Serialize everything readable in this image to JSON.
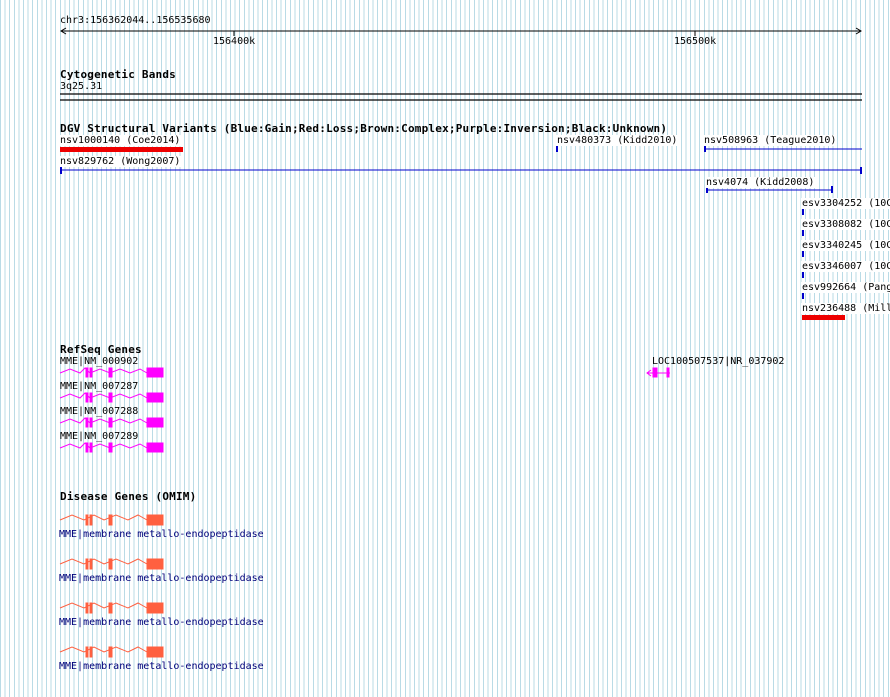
{
  "ruler": {
    "position": "chr3:156362044..156535680",
    "tick_labels": [
      "156400k",
      "156500k"
    ]
  },
  "cyto": {
    "title": "Cytogenetic Bands",
    "band": "3q25.31"
  },
  "dgv": {
    "title": "DGV Structural Variants (Blue:Gain;Red:Loss;Brown:Complex;Purple:Inversion;Black:Unknown)",
    "variants": [
      {
        "label": "nsv1000140 (Coe2014)",
        "type": "Loss"
      },
      {
        "label": "nsv480373 (Kidd2010)",
        "type": "Gain"
      },
      {
        "label": "nsv508963 (Teague2010)",
        "type": "Gain"
      },
      {
        "label": "nsv829762 (Wong2007)",
        "type": "Gain"
      },
      {
        "label": "nsv4074 (Kidd2008)",
        "type": "Gain"
      },
      {
        "label": "esv3304252 (10C",
        "type": "Gain"
      },
      {
        "label": "esv3308082 (10C",
        "type": "Gain"
      },
      {
        "label": "esv3340245 (10C",
        "type": "Gain"
      },
      {
        "label": "esv3346007 (10C",
        "type": "Gain"
      },
      {
        "label": "esv992664 (Pang",
        "type": "Gain"
      },
      {
        "label": "nsv236488 (Mill",
        "type": "Loss"
      }
    ],
    "colors": {
      "gain": "#0000cc",
      "loss": "#ee0000"
    }
  },
  "refseq": {
    "title": "RefSeq Genes",
    "genes": [
      {
        "label": "MME|NM_000902"
      },
      {
        "label": "MME|NM_007287"
      },
      {
        "label": "MME|NM_007288"
      },
      {
        "label": "MME|NM_007289"
      },
      {
        "label": "LOC100507537|NR_037902"
      }
    ],
    "color": "#ff00ff"
  },
  "omim": {
    "title": "Disease Genes (OMIM)",
    "genes": [
      {
        "label": "MME|membrane metallo-endopeptidase"
      },
      {
        "label": "MME|membrane metallo-endopeptidase"
      },
      {
        "label": "MME|membrane metallo-endopeptidase"
      },
      {
        "label": "MME|membrane metallo-endopeptidase"
      }
    ],
    "color": "#ff6040"
  },
  "colors": {
    "grid": "#b9dbe6"
  }
}
